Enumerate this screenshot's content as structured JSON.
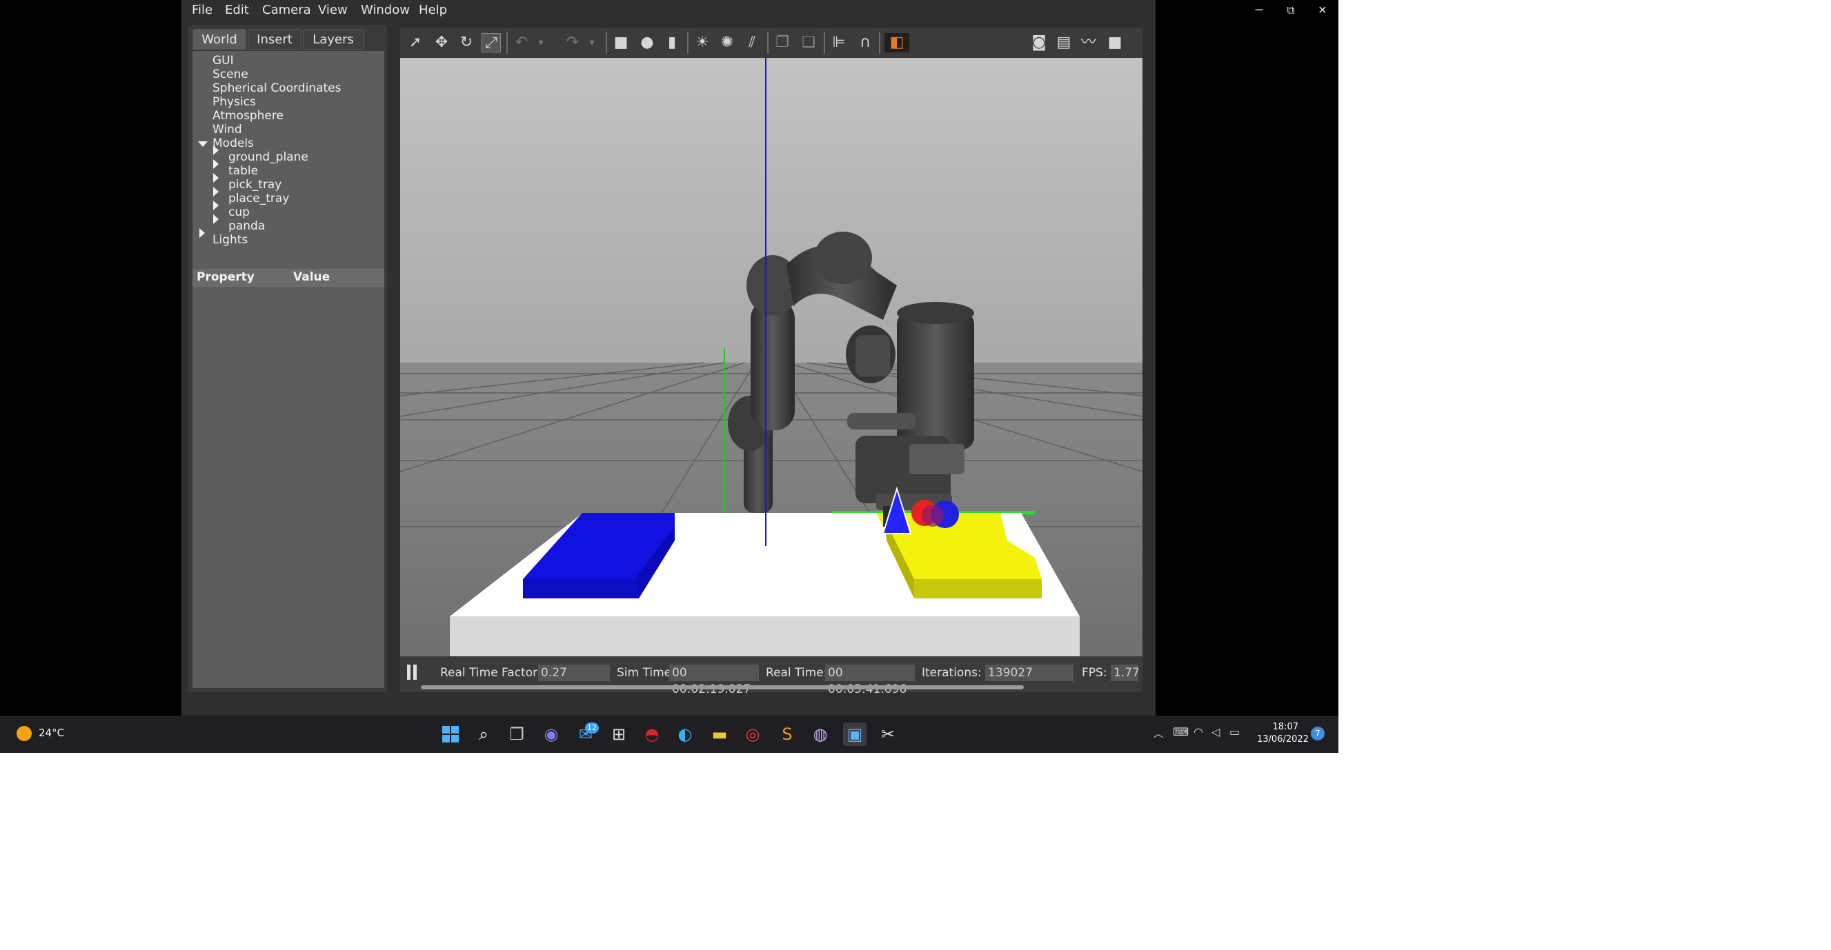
{
  "window": {
    "menus": [
      "File",
      "Edit",
      "Camera",
      "View",
      "Window",
      "Help"
    ],
    "controls": {
      "minimize": "−",
      "maximize": "⧉",
      "close": "✕"
    }
  },
  "left_panel": {
    "tabs": [
      "World",
      "Insert",
      "Layers"
    ],
    "active_tab": "World",
    "tree": {
      "gui": "GUI",
      "scene": "Scene",
      "spherical": "Spherical Coordinates",
      "physics": "Physics",
      "atmosphere": "Atmosphere",
      "wind": "Wind",
      "models": "Models",
      "model_items": [
        "ground_plane",
        "table",
        "pick_tray",
        "place_tray",
        "cup",
        "panda"
      ],
      "lights": "Lights"
    },
    "property_header": {
      "property": "Property",
      "value": "Value"
    }
  },
  "toolbar": {
    "icons": [
      "select-mode-icon",
      "translate-mode-icon",
      "rotate-mode-icon",
      "scale-mode-icon",
      "undo-icon",
      "undo-history-icon",
      "redo-icon",
      "redo-history-icon",
      "box-shape-icon",
      "sphere-shape-icon",
      "cylinder-shape-icon",
      "point-light-icon",
      "spot-light-icon",
      "directional-light-icon",
      "copy-icon",
      "paste-icon",
      "align-icon",
      "snap-icon",
      "view-angle-icon",
      "screenshot-icon",
      "log-icon",
      "plot-icon",
      "record-video-icon"
    ]
  },
  "status": {
    "rtf_label": "Real Time Factor:",
    "rtf_value": "0.27",
    "sim_label": "Sim Time:",
    "sim_value": "00 00:02:19.027",
    "real_label": "Real Time:",
    "real_value": "00 00:05:41.696",
    "iter_label": "Iterations:",
    "iter_value": "139027",
    "fps_label": "FPS:",
    "fps_value": "1.77"
  },
  "taskbar": {
    "weather": "24°C",
    "mail_badge": "12",
    "time": "18:07",
    "date": "13/06/2022",
    "notification_count": "7"
  },
  "colors": {
    "pick_tray": "#1010d8",
    "place_tray": "#e6e60e",
    "table": "#ffffff",
    "sky": "#b4b4b4"
  }
}
